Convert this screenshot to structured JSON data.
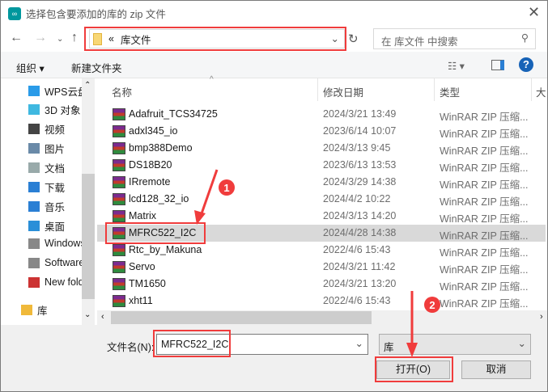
{
  "window": {
    "title": "选择包含要添加的库的 zip 文件",
    "close_icon": "close-icon"
  },
  "address": {
    "prefix": "«",
    "path": "库文件"
  },
  "search": {
    "placeholder": "在 库文件 中搜索"
  },
  "toolbar": {
    "organize": "组织 ▾",
    "new_folder": "新建文件夹",
    "help": "?"
  },
  "nav": {
    "items": [
      {
        "label": "WPS云盘",
        "icon": "cloud-icon"
      },
      {
        "label": "3D 对象",
        "icon": "cube-icon"
      },
      {
        "label": "视频",
        "icon": "video-icon"
      },
      {
        "label": "图片",
        "icon": "picture-icon"
      },
      {
        "label": "文档",
        "icon": "document-icon"
      },
      {
        "label": "下载",
        "icon": "download-icon"
      },
      {
        "label": "音乐",
        "icon": "music-icon"
      },
      {
        "label": "桌面",
        "icon": "desktop-icon"
      },
      {
        "label": "Windows",
        "icon": "drive-icon"
      },
      {
        "label": "Software",
        "icon": "drive-icon"
      },
      {
        "label": "New folder",
        "icon": "network-drive-icon"
      },
      {
        "label": "库",
        "icon": "library-icon"
      }
    ]
  },
  "columns": {
    "name": "名称",
    "date": "修改日期",
    "type": "类型",
    "size": "大"
  },
  "files": [
    {
      "name": "Adafruit_TCS34725",
      "date": "2024/3/21 13:49",
      "type": "WinRAR ZIP 压缩..."
    },
    {
      "name": "adxl345_io",
      "date": "2023/6/14 10:07",
      "type": "WinRAR ZIP 压缩..."
    },
    {
      "name": "bmp388Demo",
      "date": "2024/3/13 9:45",
      "type": "WinRAR ZIP 压缩..."
    },
    {
      "name": "DS18B20",
      "date": "2023/6/13 13:53",
      "type": "WinRAR ZIP 压缩..."
    },
    {
      "name": "IRremote",
      "date": "2024/3/29 14:38",
      "type": "WinRAR ZIP 压缩..."
    },
    {
      "name": "lcd128_32_io",
      "date": "2024/4/2 10:22",
      "type": "WinRAR ZIP 压缩..."
    },
    {
      "name": "Matrix",
      "date": "2024/3/13 14:20",
      "type": "WinRAR ZIP 压缩..."
    },
    {
      "name": "MFRC522_I2C",
      "date": "2024/4/28 14:38",
      "type": "WinRAR ZIP 压缩...",
      "selected": true
    },
    {
      "name": "Rtc_by_Makuna",
      "date": "2022/4/6 15:43",
      "type": "WinRAR ZIP 压缩..."
    },
    {
      "name": "Servo",
      "date": "2024/3/21 11:42",
      "type": "WinRAR ZIP 压缩..."
    },
    {
      "name": "TM1650",
      "date": "2024/3/21 13:20",
      "type": "WinRAR ZIP 压缩..."
    },
    {
      "name": "xht11",
      "date": "2022/4/6 15:43",
      "type": "WinRAR ZIP 压缩..."
    }
  ],
  "footer": {
    "filename_label": "文件名(N):",
    "filename_value": "MFRC522_I2C",
    "filter": "库",
    "open": "打开(O)",
    "cancel": "取消"
  },
  "annotations": {
    "step1": "1",
    "step2": "2",
    "color": "#f03c3c"
  }
}
